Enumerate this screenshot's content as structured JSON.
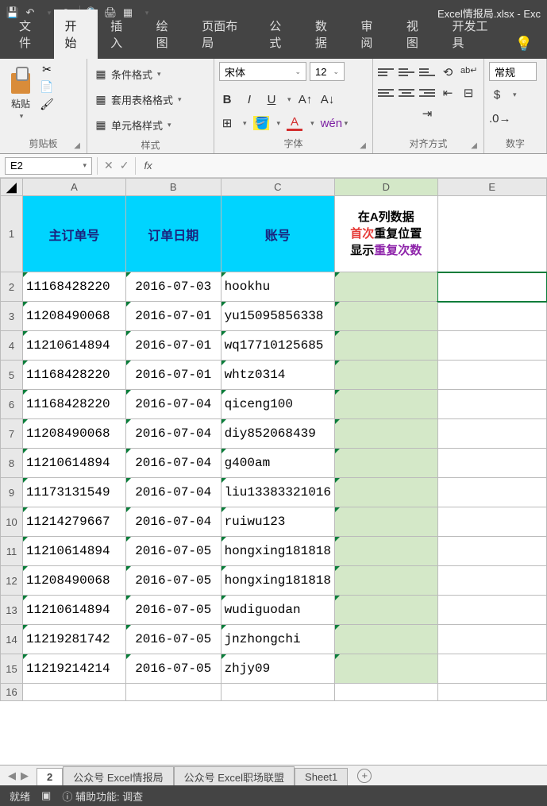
{
  "title": "Excel情报局.xlsx  -  Exc",
  "tabs": [
    "文件",
    "开始",
    "插入",
    "绘图",
    "页面布局",
    "公式",
    "数据",
    "审阅",
    "视图",
    "开发工具"
  ],
  "active_tab": 1,
  "ribbon": {
    "clipboard": {
      "label": "剪贴板",
      "paste": "粘贴"
    },
    "styles": {
      "label": "样式",
      "cond": "条件格式",
      "table": "套用表格格式",
      "cell": "单元格样式"
    },
    "font": {
      "label": "字体",
      "name": "宋体",
      "size": "12"
    },
    "align": {
      "label": "对齐方式"
    },
    "number": {
      "label": "数字",
      "general": "常规"
    }
  },
  "cell_ref": "E2",
  "columns": [
    "A",
    "B",
    "C",
    "D",
    "E"
  ],
  "headers": {
    "a": "主订单号",
    "b": "订单日期",
    "c": "账号",
    "d_l1": "在A列数据",
    "d_red": "首次",
    "d_l2": "重复位置",
    "d_l3a": "显示",
    "d_pur": "重复次数"
  },
  "rows": [
    {
      "a": "11168428220",
      "b": "2016-07-03",
      "c": "hookhu"
    },
    {
      "a": "11208490068",
      "b": "2016-07-01",
      "c": "yu15095856338"
    },
    {
      "a": "11210614894",
      "b": "2016-07-01",
      "c": "wq17710125685"
    },
    {
      "a": "11168428220",
      "b": "2016-07-01",
      "c": "whtz0314"
    },
    {
      "a": "11168428220",
      "b": "2016-07-04",
      "c": "qiceng100"
    },
    {
      "a": "11208490068",
      "b": "2016-07-04",
      "c": "diy852068439"
    },
    {
      "a": "11210614894",
      "b": "2016-07-04",
      "c": "g400am"
    },
    {
      "a": "11173131549",
      "b": "2016-07-04",
      "c": "liu13383321016"
    },
    {
      "a": "11214279667",
      "b": "2016-07-04",
      "c": "ruiwu123"
    },
    {
      "a": "11210614894",
      "b": "2016-07-05",
      "c": "hongxing181818"
    },
    {
      "a": "11208490068",
      "b": "2016-07-05",
      "c": "hongxing181818"
    },
    {
      "a": "11210614894",
      "b": "2016-07-05",
      "c": "wudiguodan"
    },
    {
      "a": "11219281742",
      "b": "2016-07-05",
      "c": "jnzhongchi"
    },
    {
      "a": "11219214214",
      "b": "2016-07-05",
      "c": "zhjy09"
    }
  ],
  "sheets": [
    "2",
    "公众号 Excel情报局",
    "公众号 Excel职场联盟",
    "Sheet1"
  ],
  "active_sheet": 0,
  "status": {
    "ready": "就绪",
    "acc": "辅助功能: 调查"
  }
}
